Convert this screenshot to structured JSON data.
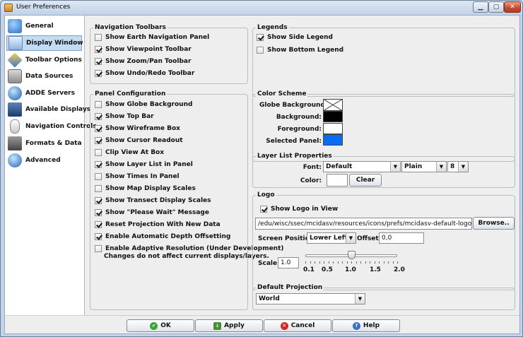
{
  "window": {
    "title": "User Preferences",
    "minimize_glyph": "▁",
    "maximize_glyph": "▢",
    "close_glyph": "✕"
  },
  "sidebar": {
    "items": [
      {
        "label": "General",
        "icon": "general-icon"
      },
      {
        "label": "Display Window",
        "icon": "display-window-icon",
        "selected": true
      },
      {
        "label": "Toolbar Options",
        "icon": "toolbar-options-icon"
      },
      {
        "label": "Data Sources",
        "icon": "data-sources-icon"
      },
      {
        "label": "ADDE Servers",
        "icon": "adde-servers-icon"
      },
      {
        "label": "Available Displays",
        "icon": "available-displays-icon"
      },
      {
        "label": "Navigation Controls",
        "icon": "navigation-controls-icon"
      },
      {
        "label": "Formats & Data",
        "icon": "formats-data-icon"
      },
      {
        "label": "Advanced",
        "icon": "advanced-icon"
      }
    ]
  },
  "nav_toolbars": {
    "title": "Navigation Toolbars",
    "items": [
      {
        "label": "Show Earth Navigation Panel",
        "checked": false
      },
      {
        "label": "Show Viewpoint Toolbar",
        "checked": true
      },
      {
        "label": "Show Zoom/Pan Toolbar",
        "checked": true
      },
      {
        "label": "Show Undo/Redo Toolbar",
        "checked": true
      }
    ]
  },
  "panel_config": {
    "title": "Panel Configuration",
    "items": [
      {
        "label": "Show Globe Background",
        "checked": false
      },
      {
        "label": "Show Top Bar",
        "checked": true
      },
      {
        "label": "Show Wireframe Box",
        "checked": true
      },
      {
        "label": "Show Cursor Readout",
        "checked": true
      },
      {
        "label": "Clip View At Box",
        "checked": false
      },
      {
        "label": "Show Layer List in Panel",
        "checked": true
      },
      {
        "label": "Show Times In Panel",
        "checked": false
      },
      {
        "label": "Show Map Display Scales",
        "checked": false
      },
      {
        "label": "Show Transect Display Scales",
        "checked": true
      },
      {
        "label": "Show \"Please Wait\" Message",
        "checked": true
      },
      {
        "label": "Reset Projection With New Data",
        "checked": true
      },
      {
        "label": "Enable Automatic Depth Offsetting",
        "checked": true
      },
      {
        "label": "Enable Adaptive Resolution (Under Development)",
        "checked": false
      }
    ],
    "adaptive_note": "Changes do not affect current displays/layers."
  },
  "legends": {
    "title": "Legends",
    "items": [
      {
        "label": "Show Side Legend",
        "checked": true
      },
      {
        "label": "Show Bottom Legend",
        "checked": false
      }
    ]
  },
  "color_scheme": {
    "title": "Color Scheme",
    "globe_bg_label": "Globe Background:",
    "background_label": "Background:",
    "foreground_label": "Foreground:",
    "selected_panel_label": "Selected Panel:",
    "colors": {
      "background": "#000000",
      "foreground": "#ffffff",
      "selected_panel": "#0a6cf0"
    }
  },
  "layer_list": {
    "title": "Layer List Properties",
    "font_label": "Font:",
    "font_value": "Default",
    "style_value": "Plain",
    "size_value": "8",
    "color_label": "Color:",
    "color_value": "#ffffff",
    "clear_label": "Clear"
  },
  "logo": {
    "title": "Logo",
    "show_logo_label": "Show Logo in View",
    "show_logo_checked": true,
    "path_value": "/edu/wisc/ssec/mcidasv/resources/icons/prefs/mcidasv-default-logo.png",
    "browse_label": "Browse..",
    "screen_position_label": "Screen Position:",
    "screen_position_value": "Lower Left",
    "offset_label": "Offset:",
    "offset_value": "0,0",
    "scale_label": "Scale:",
    "scale_value": "1.0",
    "scale_min": 0.0,
    "scale_max": 2.0,
    "slider_value": 1.0,
    "tick_labels": [
      "0.1",
      "0.5",
      "1.0",
      "1.5",
      "2.0"
    ]
  },
  "default_projection": {
    "title": "Default Projection",
    "value": "World"
  },
  "buttons": {
    "ok": "OK",
    "apply": "Apply",
    "cancel": "Cancel",
    "help": "Help"
  }
}
